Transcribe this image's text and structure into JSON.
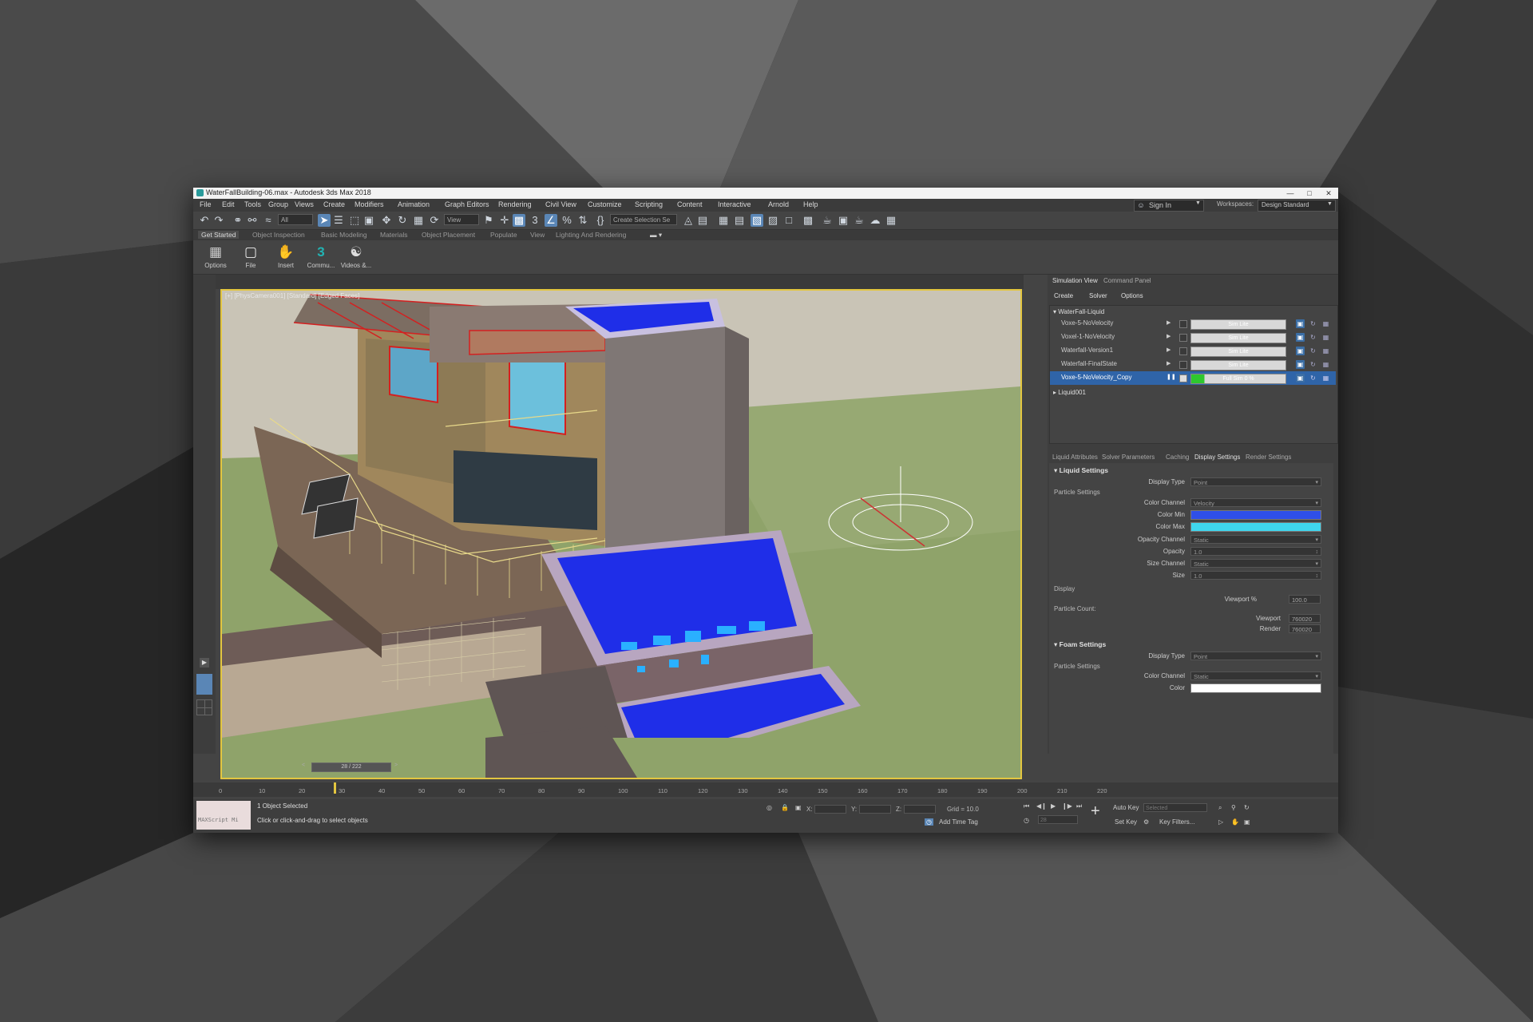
{
  "window": {
    "title": "WaterFallBuilding-06.max - Autodesk 3ds Max 2018"
  },
  "menu": [
    "File",
    "Edit",
    "Tools",
    "Group",
    "Views",
    "Create",
    "Modifiers",
    "Animation",
    "Graph Editors",
    "Rendering",
    "Civil View",
    "Customize",
    "Scripting",
    "Content",
    "Interactive",
    "Arnold",
    "Help"
  ],
  "account": {
    "signin_label": "Sign In",
    "workspaces_label": "Workspaces:",
    "workspace_value": "Design Standard"
  },
  "toolbar": {
    "filter_value": "All",
    "ref_coord_value": "View",
    "selection_set_placeholder": "Create Selection Se"
  },
  "ribbon_tabs": [
    "Get Started",
    "Object Inspection",
    "Basic Modeling",
    "Materials",
    "Object Placement",
    "Populate",
    "View",
    "Lighting And Rendering"
  ],
  "ribbon_buttons": [
    {
      "label": "Options"
    },
    {
      "label": "File"
    },
    {
      "label": "Insert"
    },
    {
      "label": "Commu..."
    },
    {
      "label": "Videos &..."
    }
  ],
  "viewport": {
    "label": "[+] [PhysCamera001] [Standard] [Edged Faces]"
  },
  "panel_tabs": {
    "simulation_view": "Simulation View",
    "command_panel": "Command Panel"
  },
  "sim_subtabs": [
    "Create",
    "Solver",
    "Options"
  ],
  "sim_tree": {
    "group1": "WaterFall-Liquid",
    "items": [
      {
        "name": "Voxe-5-NoVelocity",
        "bar": "Sim Lite"
      },
      {
        "name": "Voxel-1-NoVelocity",
        "bar": "Sim Lite"
      },
      {
        "name": "Waterfall-Version1",
        "bar": "Sim Lite"
      },
      {
        "name": "Waterfall-FinalState",
        "bar": "Sim Lite"
      },
      {
        "name": "Voxe-5-NoVelocity_Copy",
        "bar": "Full Sim 0 %"
      }
    ],
    "group2": "Liquid001"
  },
  "prop_tabs": [
    "Liquid Attributes",
    "Solver Parameters",
    "Caching",
    "Display Settings",
    "Render Settings"
  ],
  "liquid_settings": {
    "title": "Liquid Settings",
    "display_type_label": "Display Type",
    "display_type": "Point",
    "particle_settings": "Particle Settings",
    "color_channel_label": "Color Channel",
    "color_channel": "Velocity",
    "color_min_label": "Color Min",
    "color_min": "#2f4fe8",
    "color_max_label": "Color Max",
    "color_max": "#3fd6ee",
    "opacity_channel_label": "Opacity Channel",
    "opacity_channel": "Static",
    "opacity_label": "Opacity",
    "opacity": "1.0",
    "size_channel_label": "Size Channel",
    "size_channel": "Static",
    "size_label": "Size",
    "size": "1.0"
  },
  "display": {
    "title": "Display",
    "viewport_pct_label": "Viewport %",
    "viewport_pct": "100.0",
    "particle_count": "Particle Count:",
    "viewport_label": "Viewport",
    "viewport_count": "760020",
    "render_label": "Render",
    "render_count": "760020"
  },
  "foam_settings": {
    "title": "Foam Settings",
    "display_type_label": "Display Type",
    "display_type": "Point",
    "particle_settings": "Particle Settings",
    "color_channel_label": "Color Channel",
    "color_channel": "Static",
    "color_label": "Color",
    "color": "#ffffff"
  },
  "timeline": {
    "frame_display": "28 / 222",
    "current_frame": 28,
    "total_frames": 222,
    "ticks": [
      "0",
      "10",
      "20",
      "30",
      "40",
      "50",
      "60",
      "70",
      "80",
      "90",
      "100",
      "110",
      "120",
      "130",
      "140",
      "150",
      "160",
      "170",
      "180",
      "190",
      "200",
      "210",
      "220"
    ]
  },
  "status": {
    "maxscript": "MAXScript Mi",
    "selection": "1 Object Selected",
    "prompt": "Click or click-and-drag to select objects",
    "x_label": "X:",
    "y_label": "Y:",
    "z_label": "Z:",
    "grid": "Grid = 10.0",
    "add_time_tag": "Add Time Tag",
    "auto_key": "Auto Key",
    "set_key": "Set Key",
    "selected": "Selected",
    "key_filters": "Key Filters...",
    "frame_field": "28"
  },
  "colors": {
    "accent_blue": "#2f64a8",
    "viewport_border": "#e3c640",
    "water": "#1f2ee8"
  }
}
